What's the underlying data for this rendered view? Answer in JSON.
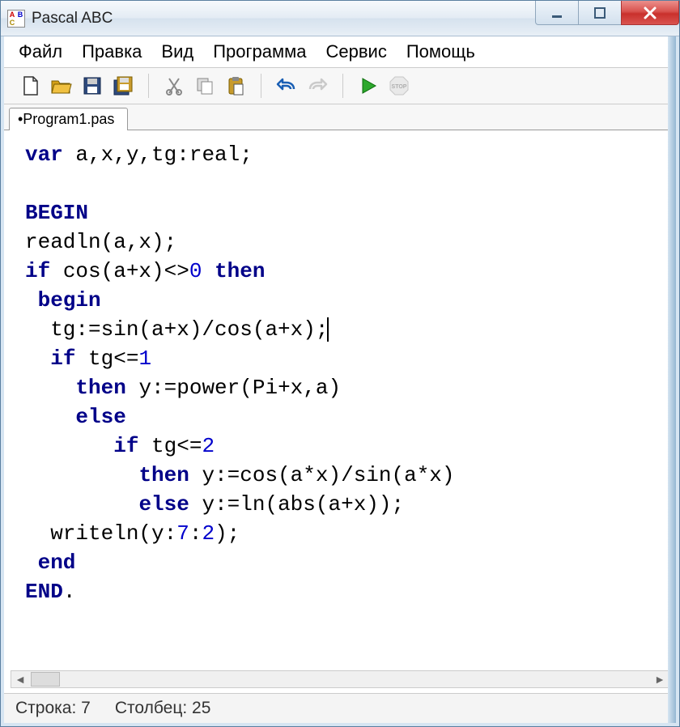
{
  "window": {
    "title": "Pascal ABC"
  },
  "menubar": {
    "items": [
      "Файл",
      "Правка",
      "Вид",
      "Программа",
      "Сервис",
      "Помощь"
    ]
  },
  "toolbar_icons": {
    "new": "new-file-icon",
    "open": "open-folder-icon",
    "save": "save-icon",
    "save_all": "save-all-icon",
    "cut": "cut-icon",
    "copy": "copy-icon",
    "paste": "paste-icon",
    "undo": "undo-icon",
    "redo": "redo-icon",
    "run": "run-icon",
    "stop": "stop-icon"
  },
  "tab": {
    "label": "•Program1.pas"
  },
  "code": {
    "l1a": "var",
    "l1b": " a,x,y,tg:real;",
    "l2": "",
    "l3": "BEGIN",
    "l4": "readln(a,x);",
    "l5a": "if",
    "l5b": " cos(a+x)<>",
    "l5n": "0",
    "l5c": " ",
    "l5d": "then",
    "l6": " begin",
    "l7": "  tg:=sin(a+x)/cos(a+x);",
    "l8a": "  ",
    "l8b": "if",
    "l8c": " tg<=",
    "l8n": "1",
    "l9a": "    ",
    "l9b": "then",
    "l9c": " y:=power(Pi+x,a)",
    "l10a": "    ",
    "l10b": "else",
    "l11a": "       ",
    "l11b": "if",
    "l11c": " tg<=",
    "l11n": "2",
    "l12a": "         ",
    "l12b": "then",
    "l12c": " y:=cos(a*x)/sin(a*x)",
    "l13a": "         ",
    "l13b": "else",
    "l13c": " y:=ln(abs(a+x));",
    "l14a": "  writeln(y:",
    "l14n1": "7",
    "l14b": ":",
    "l14n2": "2",
    "l14c": ");",
    "l15": " end",
    "l16": "END",
    "l16b": "."
  },
  "status": {
    "row_label": "Строка:",
    "row_value": "7",
    "col_label": "Столбец:",
    "col_value": "25"
  }
}
